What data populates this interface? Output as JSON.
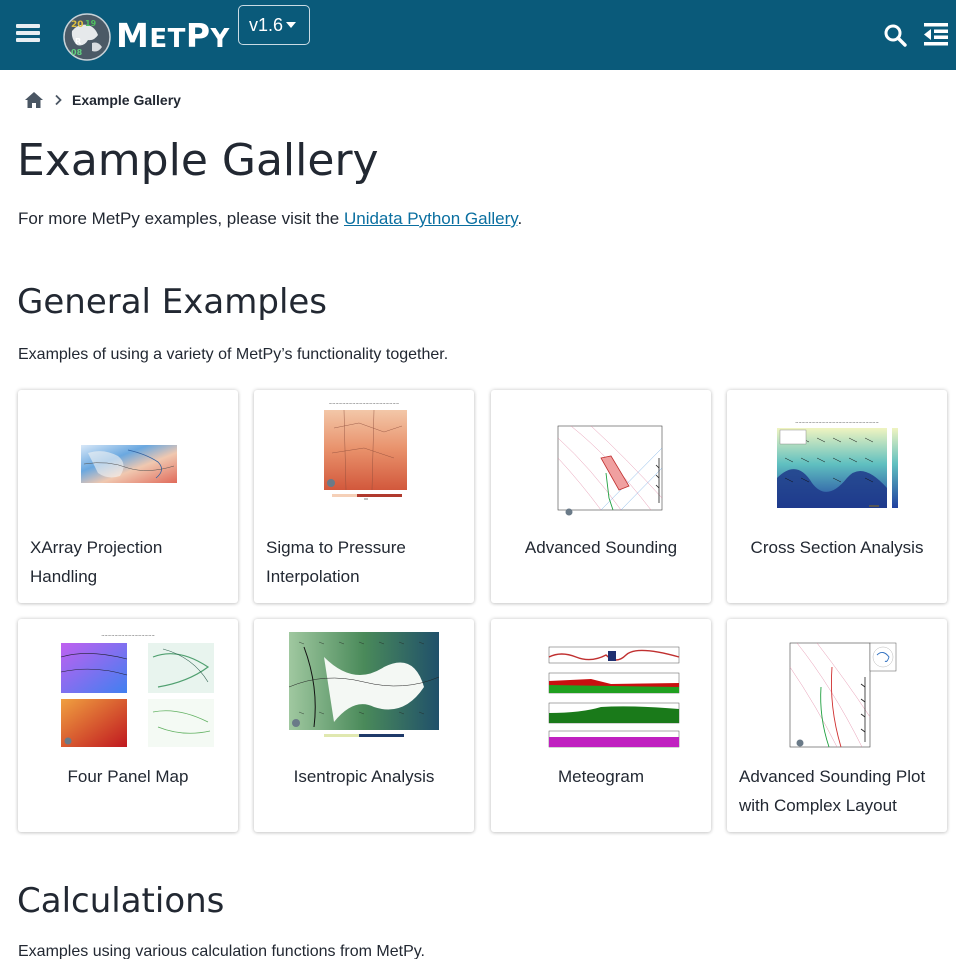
{
  "header": {
    "logo_text_big": "M",
    "logo_text_small": "ET",
    "logo_text_end": "P",
    "logo_text_y": "Y",
    "version_label": "v1.6"
  },
  "breadcrumb": {
    "current": "Example Gallery"
  },
  "page": {
    "title": "Example Gallery",
    "intro_prefix": "For more MetPy examples, please visit the ",
    "intro_link": "Unidata Python Gallery",
    "intro_suffix": "."
  },
  "sections": {
    "general": {
      "title": "General Examples",
      "description": "Examples of using a variety of MetPy’s functionality together."
    },
    "calculations": {
      "title": "Calculations",
      "description": "Examples using various calculation functions from MetPy."
    }
  },
  "gallery": [
    {
      "label": "XArray Projection Handling",
      "thumb": "map-temperature-thumbnail"
    },
    {
      "label": "Sigma to Pressure Interpolation",
      "thumb": "map-orange-thumbnail"
    },
    {
      "label": "Advanced Sounding",
      "thumb": "skewt-thumbnail"
    },
    {
      "label": "Cross Section Analysis",
      "thumb": "cross-section-thumbnail"
    },
    {
      "label": "Four Panel Map",
      "thumb": "four-panel-thumbnail"
    },
    {
      "label": "Isentropic Analysis",
      "thumb": "isentropic-thumbnail"
    },
    {
      "label": "Meteogram",
      "thumb": "meteogram-thumbnail"
    },
    {
      "label": "Advanced Sounding Plot with Complex Layout",
      "thumb": "skewt-hodograph-thumbnail"
    }
  ],
  "colors": {
    "navbar": "#0a5a7a",
    "link": "#0a6fa0",
    "text": "#222832"
  }
}
